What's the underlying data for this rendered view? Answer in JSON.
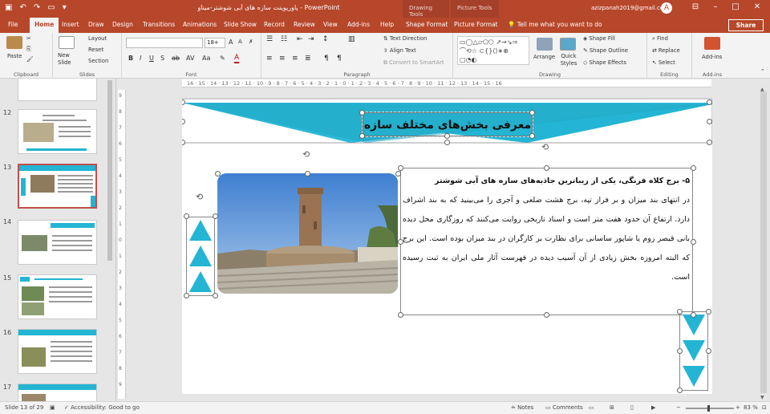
{
  "window": {
    "title": "پاورپوینت سازه های آبی شوشتر-میناو - PowerPoint",
    "context_tabs": [
      "Drawing Tools",
      "Picture Tools"
    ],
    "user": "azizpanah2019@gmail.com",
    "avatar": "A"
  },
  "ribbon_tabs": [
    "File",
    "Home",
    "Insert",
    "Draw",
    "Design",
    "Transitions",
    "Animations",
    "Slide Show",
    "Record",
    "Review",
    "View",
    "Add-ins",
    "Help",
    "Shape Format",
    "Picture Format"
  ],
  "active_tab": "Home",
  "tell_me": "Tell me what you want to do",
  "share_label": "Share",
  "ribbon": {
    "clipboard": {
      "paste": "Paste",
      "label": "Clipboard"
    },
    "slides": {
      "new_slide": "New Slide",
      "layout": "Layout",
      "reset": "Reset",
      "section": "Section",
      "label": "Slides"
    },
    "font": {
      "font_name": "",
      "font_size": "18+",
      "label": "Font"
    },
    "paragraph": {
      "text_direction": "Text Direction",
      "align_text": "Align Text",
      "convert_smartart": "Convert to SmartArt",
      "label": "Paragraph"
    },
    "drawing": {
      "arrange": "Arrange",
      "quick_styles": "Quick Styles",
      "shape_fill": "Shape Fill",
      "shape_outline": "Shape Outline",
      "shape_effects": "Shape Effects",
      "label": "Drawing"
    },
    "editing": {
      "find": "Find",
      "replace": "Replace",
      "select": "Select",
      "label": "Editing"
    },
    "addins": {
      "addins": "Add-ins",
      "label": "Add-ins"
    }
  },
  "thumbnails": [
    {
      "num": "12",
      "active": false
    },
    {
      "num": "13",
      "active": true
    },
    {
      "num": "14",
      "active": false
    },
    {
      "num": "15",
      "active": false
    },
    {
      "num": "16",
      "active": false
    },
    {
      "num": "17",
      "active": false
    }
  ],
  "ruler_numbers": "16 · 15 · 14 · 13 · 12 · 11 · 10 · 9 · 8 · 7 · 6 · 5 · 4 · 3 · 2 · 1 · 0 · 1 · 2 · 3 · 4 · 5 · 6 · 7 · 8 · 9 · 10 · 11 · 12 · 13 · 14 · 15 · 16",
  "ruler_left_numbers": [
    "9",
    "8",
    "7",
    "6",
    "5",
    "4",
    "3",
    "2",
    "1",
    "0",
    "1",
    "2",
    "3",
    "4",
    "5",
    "6",
    "7",
    "8",
    "9"
  ],
  "slide": {
    "title": "معرفی بخش‌های مختلف سازه",
    "heading": "۵- برج کلاه فرنگی، یکی از زیباترین جاذبه‌های سازه های آبی شوشتر",
    "body": "در انتهای بند میزان و بر فراز تپه، برج هشت ضلعی و آجری را می‌بینید که به بند اشراف دارد. ارتفاع آن حدود هفت متر است و اسناد تاریخی روایت می‌کنند که روزگاری محل دیده بانی قیصر روم یا شاپور ساسانی برای نظارت بر کارگران در بند میزان بوده است. این برج که البته امروزه بخش زیادی از آن آسیب دیده در فهرست آثار ملی ایران به ثبت رسیده است.",
    "accent_color": "#23b5d3"
  },
  "statusbar": {
    "slide_info": "Slide 13 of 29",
    "accessibility": "Accessibility: Good to go",
    "notes": "Notes",
    "comments": "Comments",
    "zoom": "83 %"
  }
}
